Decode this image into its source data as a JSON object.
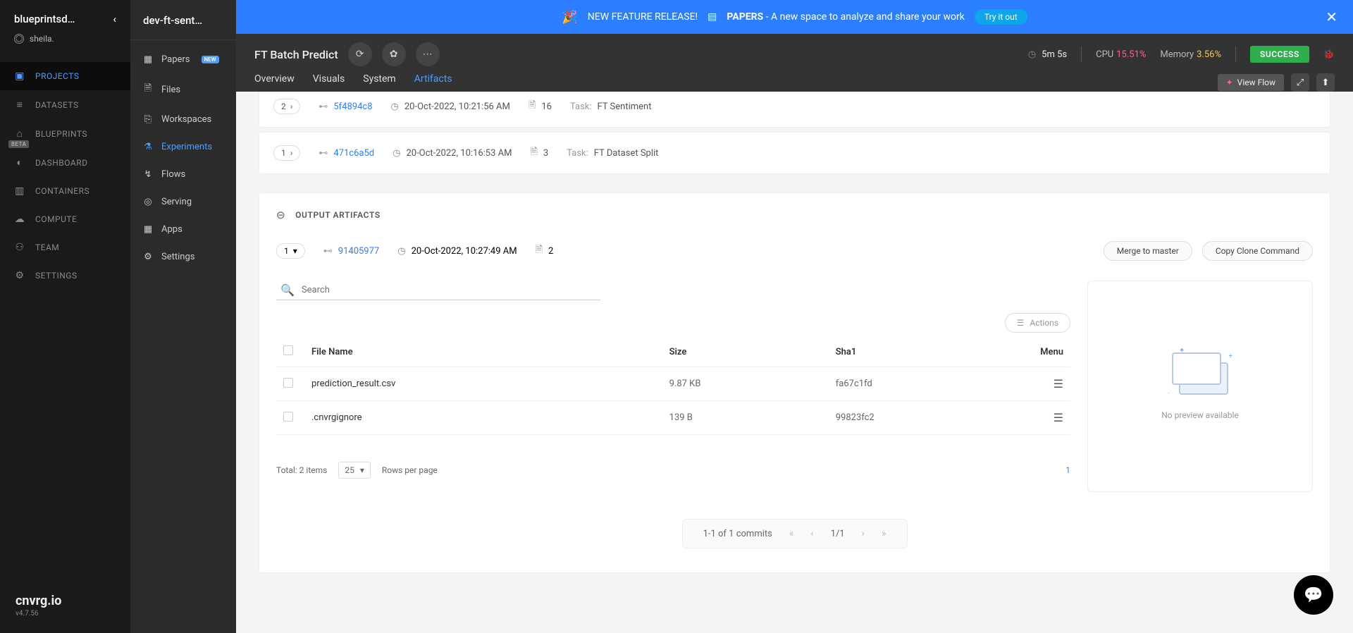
{
  "org": {
    "name": "blueprintsd…",
    "user": "sheila."
  },
  "brand": {
    "name": "cnvrg.io",
    "version": "v4.7.56"
  },
  "nav1": [
    {
      "label": "PROJECTS",
      "icon": "▣",
      "active": true
    },
    {
      "label": "DATASETS",
      "icon": "≡"
    },
    {
      "label": "BLUEPRINTS",
      "icon": "⌂",
      "beta": "BETA"
    },
    {
      "label": "DASHBOARD",
      "icon": "◐"
    },
    {
      "label": "CONTAINERS",
      "icon": "▥"
    },
    {
      "label": "COMPUTE",
      "icon": "☁"
    },
    {
      "label": "TEAM",
      "icon": "⚇"
    },
    {
      "label": "SETTINGS",
      "icon": "⚙"
    }
  ],
  "project": {
    "name": "dev-ft-sent…"
  },
  "nav2": [
    {
      "label": "Papers",
      "icon": "▦",
      "new": true
    },
    {
      "label": "Files",
      "icon": "🗎"
    },
    {
      "label": "Workspaces",
      "icon": "⎘"
    },
    {
      "label": "Experiments",
      "icon": "⚗",
      "active": true
    },
    {
      "label": "Flows",
      "icon": "↯"
    },
    {
      "label": "Serving",
      "icon": "◎"
    },
    {
      "label": "Apps",
      "icon": "▦"
    },
    {
      "label": "Settings",
      "icon": "⚙"
    }
  ],
  "banner": {
    "pre": "NEW FEATURE RELEASE!",
    "bold": "PAPERS",
    "rest": " - A new space to analyze and share your work",
    "cta": "Try it out"
  },
  "header": {
    "title": "FT Batch Predict",
    "duration": "5m 5s",
    "cpu_label": "CPU",
    "cpu_val": "15.51%",
    "mem_label": "Memory",
    "mem_val": "3.56%",
    "status": "SUCCESS",
    "viewflow": "View Flow"
  },
  "tabs": [
    "Overview",
    "Visuals",
    "System",
    "Artifacts"
  ],
  "tab_active": "Artifacts",
  "input_artifacts": [
    {
      "badge": "2",
      "commit": "5f4894c8",
      "date": "20-Oct-2022, 10:21:56 AM",
      "files": "16",
      "task": "FT Sentiment"
    },
    {
      "badge": "1",
      "commit": "471c6a5d",
      "date": "20-Oct-2022, 10:16:53 AM",
      "files": "3",
      "task": "FT Dataset Split"
    }
  ],
  "output": {
    "heading": "OUTPUT ARTIFACTS",
    "badge": "1",
    "commit": "91405977",
    "date": "20-Oct-2022, 10:27:49 AM",
    "files": "2",
    "merge": "Merge to master",
    "clone": "Copy Clone Command",
    "search_placeholder": "Search",
    "actions_btn": "Actions",
    "columns": {
      "name": "File Name",
      "size": "Size",
      "sha": "Sha1",
      "menu": "Menu"
    },
    "rows": [
      {
        "name": "prediction_result.csv",
        "size": "9.87 KB",
        "sha": "fa67c1fd"
      },
      {
        "name": ".cnvrgignore",
        "size": "139 B",
        "sha": "99823fc2"
      }
    ],
    "preview_empty": "No preview available",
    "total": "Total: 2 items",
    "page_size": "25",
    "rows_per_page": "Rows per page",
    "page_link": "1",
    "commits_range": "1-1 of 1 commits",
    "commits_page": "1/1"
  }
}
